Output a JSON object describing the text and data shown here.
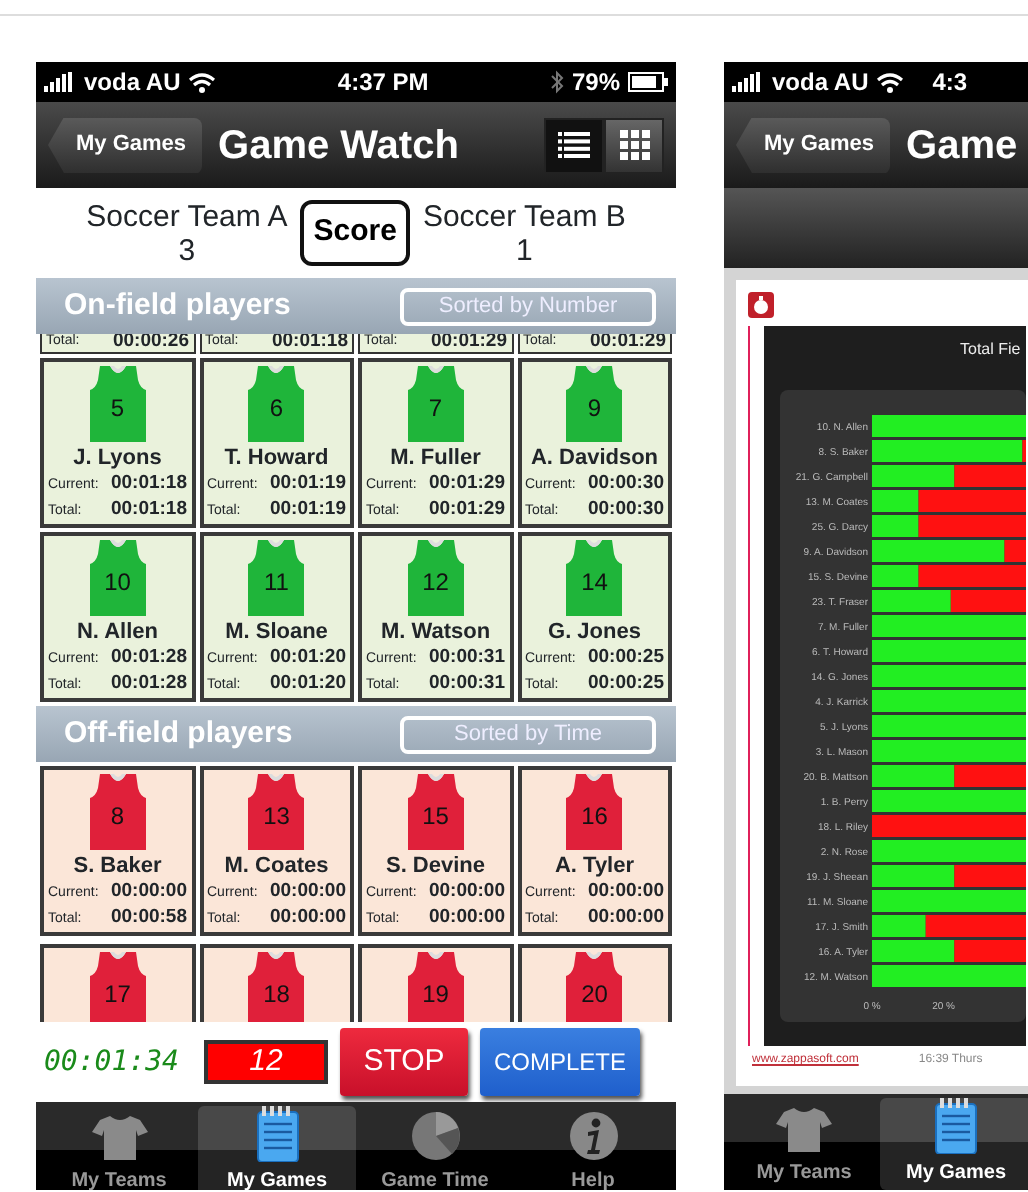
{
  "left_screen": {
    "status_bar": {
      "carrier": "voda AU",
      "time": "4:37 PM",
      "battery": "79%"
    },
    "nav_bar": {
      "back": "My Games",
      "title": "Game Watch",
      "view_toggle": [
        {
          "kind": "list",
          "selected": true
        },
        {
          "kind": "grid",
          "selected": false
        }
      ]
    },
    "score": {
      "team_a": "Soccer Team A",
      "score_a": "3",
      "button": "Score",
      "team_b": "Soccer Team B",
      "score_b": "1"
    },
    "sections": [
      {
        "kind": "on_field",
        "title": "On-field players",
        "sort": "Sorted by Number",
        "partial_totals": [
          {
            "label": "Total:",
            "value": "00:00:26"
          },
          {
            "label": "Total:",
            "value": "00:01:18"
          },
          {
            "label": "Total:",
            "value": "00:01:29"
          },
          {
            "label": "Total:",
            "value": "00:01:29"
          }
        ],
        "players": [
          {
            "number": "5",
            "name": "J. Lyons",
            "current_label": "Current:",
            "current": "00:01:18",
            "total_label": "Total:",
            "total": "00:01:18"
          },
          {
            "number": "6",
            "name": "T. Howard",
            "current_label": "Current:",
            "current": "00:01:19",
            "total_label": "Total:",
            "total": "00:01:19"
          },
          {
            "number": "7",
            "name": "M. Fuller",
            "current_label": "Current:",
            "current": "00:01:29",
            "total_label": "Total:",
            "total": "00:01:29"
          },
          {
            "number": "9",
            "name": "A. Davidson",
            "current_label": "Current:",
            "current": "00:00:30",
            "total_label": "Total:",
            "total": "00:00:30"
          },
          {
            "number": "10",
            "name": "N. Allen",
            "current_label": "Current:",
            "current": "00:01:28",
            "total_label": "Total:",
            "total": "00:01:28"
          },
          {
            "number": "11",
            "name": "M. Sloane",
            "current_label": "Current:",
            "current": "00:01:20",
            "total_label": "Total:",
            "total": "00:01:20"
          },
          {
            "number": "12",
            "name": "M. Watson",
            "current_label": "Current:",
            "current": "00:00:31",
            "total_label": "Total:",
            "total": "00:00:31"
          },
          {
            "number": "14",
            "name": "G. Jones",
            "current_label": "Current:",
            "current": "00:00:25",
            "total_label": "Total:",
            "total": "00:00:25"
          }
        ]
      },
      {
        "kind": "off_field",
        "title": "Off-field players",
        "sort": "Sorted by Time",
        "players": [
          {
            "number": "8",
            "name": "S. Baker",
            "current_label": "Current:",
            "current": "00:00:00",
            "total_label": "Total:",
            "total": "00:00:58"
          },
          {
            "number": "13",
            "name": "M. Coates",
            "current_label": "Current:",
            "current": "00:00:00",
            "total_label": "Total:",
            "total": "00:00:00"
          },
          {
            "number": "15",
            "name": "S. Devine",
            "current_label": "Current:",
            "current": "00:00:00",
            "total_label": "Total:",
            "total": "00:00:00"
          },
          {
            "number": "16",
            "name": "A. Tyler",
            "current_label": "Current:",
            "current": "00:00:00",
            "total_label": "Total:",
            "total": "00:00:00"
          }
        ],
        "partial_players": [
          {
            "number": "17"
          },
          {
            "number": "18"
          },
          {
            "number": "19"
          },
          {
            "number": "20"
          }
        ]
      }
    ],
    "bottom_bar": {
      "timer": "00:01:34",
      "counter": "12",
      "stop": "STOP",
      "complete": "COMPLETE"
    },
    "tab_bar": [
      {
        "kind": "teams",
        "label": "My Teams",
        "selected": false
      },
      {
        "kind": "games",
        "label": "My Games",
        "selected": true
      },
      {
        "kind": "time",
        "label": "Game Time",
        "selected": false
      },
      {
        "kind": "help",
        "label": "Help",
        "selected": false
      }
    ]
  },
  "right_screen": {
    "status_bar": {
      "carrier": "voda AU",
      "time": "4:3"
    },
    "nav_bar": {
      "back": "My Games",
      "title": "Game"
    },
    "report": {
      "footer_link": "www.zappasoft.com",
      "footer_date": "16:39 Thurs",
      "chart_data": {
        "type": "bar",
        "orientation": "horizontal",
        "stacked": true,
        "title": "Total Fie",
        "categories": [
          "10. N. Allen",
          "8. S. Baker",
          "21. G. Campbell",
          "13. M. Coates",
          "25. G. Darcy",
          "9. A. Davidson",
          "15. S. Devine",
          "23. T. Fraser",
          "7. M. Fuller",
          "6. T. Howard",
          "14. G. Jones",
          "4. J. Karrick",
          "5. J. Lyons",
          "3. L. Mason",
          "20. B. Mattson",
          "1. B. Perry",
          "18. L. Riley",
          "2. N. Rose",
          "19. J. Sheean",
          "11. M. Sloane",
          "17. J. Smith",
          "16. A. Tyler",
          "12. M. Watson"
        ],
        "series": [
          {
            "color": "#22ee22",
            "values": [
              43,
              42,
              23,
              13,
              13,
              37,
              13,
              22,
              43,
              43,
              43,
              43,
              43,
              43,
              23,
              43,
              0,
              43,
              23,
              43,
              15,
              23,
              43
            ]
          },
          {
            "color": "#ff1111",
            "values": [
              null,
              1,
              20,
              30,
              30,
              6,
              30,
              21,
              null,
              null,
              null,
              null,
              null,
              null,
              20,
              null,
              43,
              null,
              20,
              null,
              28,
              20,
              null
            ]
          }
        ],
        "xlim": [
          0,
          43
        ],
        "xticks": [
          {
            "value": 0,
            "label": "0 %"
          },
          {
            "value": 20,
            "label": "20 %"
          }
        ]
      }
    },
    "tab_bar": [
      {
        "kind": "teams",
        "label": "My Teams",
        "selected": false
      },
      {
        "kind": "games",
        "label": "My Games",
        "selected": true
      }
    ]
  }
}
